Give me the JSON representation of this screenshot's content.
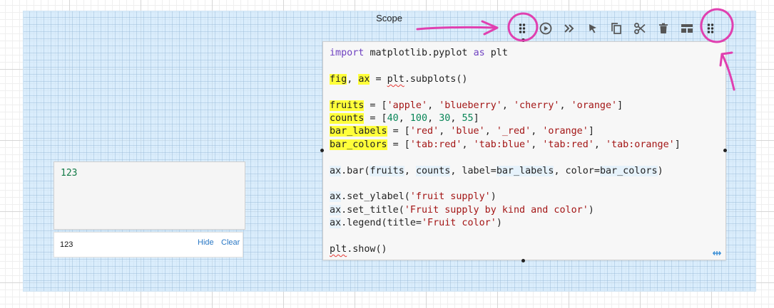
{
  "scope": {
    "title": "Scope"
  },
  "toolbar": {
    "buttons": [
      {
        "name": "drag-handle",
        "icon": "drag-dots-icon"
      },
      {
        "name": "run",
        "icon": "play-circle-icon"
      },
      {
        "name": "run-all",
        "icon": "double-chevron-right-icon"
      },
      {
        "name": "select",
        "icon": "cursor-icon"
      },
      {
        "name": "copy",
        "icon": "copy-icon"
      },
      {
        "name": "cut",
        "icon": "scissors-icon"
      },
      {
        "name": "delete",
        "icon": "trash-icon"
      },
      {
        "name": "layout",
        "icon": "layout-icon"
      },
      {
        "name": "drag-handle-2",
        "icon": "drag-dots-icon"
      }
    ]
  },
  "code_cell": {
    "lines": [
      "import matplotlib.pyplot as plt",
      "",
      "fig, ax = plt.subplots()",
      "",
      "fruits = ['apple', 'blueberry', 'cherry', 'orange']",
      "counts = [40, 100, 30, 55]",
      "bar_labels = ['red', 'blue', '_red', 'orange']",
      "bar_colors = ['tab:red', 'tab:blue', 'tab:red', 'tab:orange']",
      "",
      "ax.bar(fruits, counts, label=bar_labels, color=bar_colors)",
      "",
      "ax.set_ylabel('fruit supply')",
      "ax.set_title('Fruit supply by kind and color')",
      "ax.legend(title='Fruit color')",
      "",
      "plt.show()"
    ]
  },
  "value_cell": {
    "value": "123"
  },
  "output": {
    "value": "123",
    "hide_label": "Hide",
    "clear_label": "Clear"
  },
  "colors": {
    "annotation": "#e040b0",
    "scope_bg": "#c4e2fa",
    "highlight": "#ffff3a",
    "string": "#a31515",
    "number": "#098658",
    "link": "#2a78c5"
  }
}
